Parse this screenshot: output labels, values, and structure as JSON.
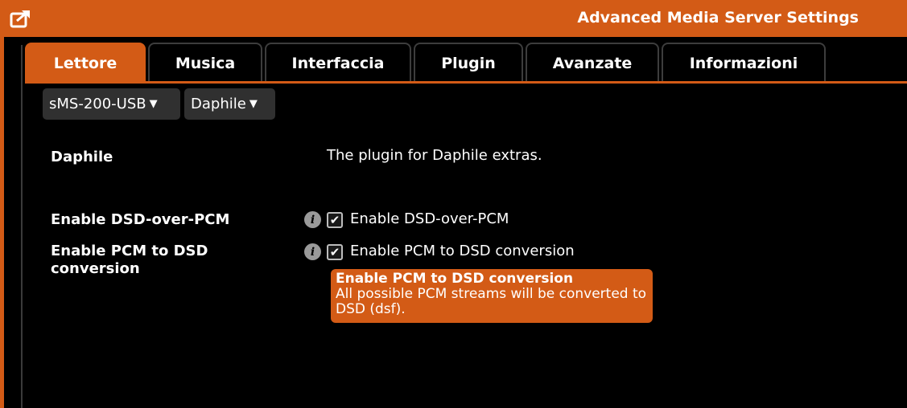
{
  "window": {
    "title": "Advanced Media Server Settings",
    "accent_color": "#d35b16",
    "export_icon": "export-window-icon"
  },
  "tabs": [
    {
      "label": "Lettore",
      "active": true
    },
    {
      "label": "Musica",
      "active": false
    },
    {
      "label": "Interfaccia",
      "active": false
    },
    {
      "label": "Plugin",
      "active": false
    },
    {
      "label": "Avanzate",
      "active": false
    },
    {
      "label": "Informazioni",
      "active": false
    }
  ],
  "player_select": {
    "value": "sMS-200-USB"
  },
  "plugin_select": {
    "value": "Daphile"
  },
  "plugin": {
    "name": "Daphile",
    "description": "The plugin for Daphile extras."
  },
  "settings": [
    {
      "label": "Enable DSD-over-PCM",
      "checkbox_label": "Enable DSD-over-PCM",
      "checked": true,
      "info_icon": "info-icon"
    },
    {
      "label": "Enable PCM to DSD conversion",
      "checkbox_label": "Enable PCM to DSD conversion",
      "checked": true,
      "info_icon": "info-icon"
    }
  ],
  "tooltip": {
    "title": "Enable PCM to DSD conversion",
    "text": "All possible PCM streams will be converted to DSD (dsf)."
  }
}
